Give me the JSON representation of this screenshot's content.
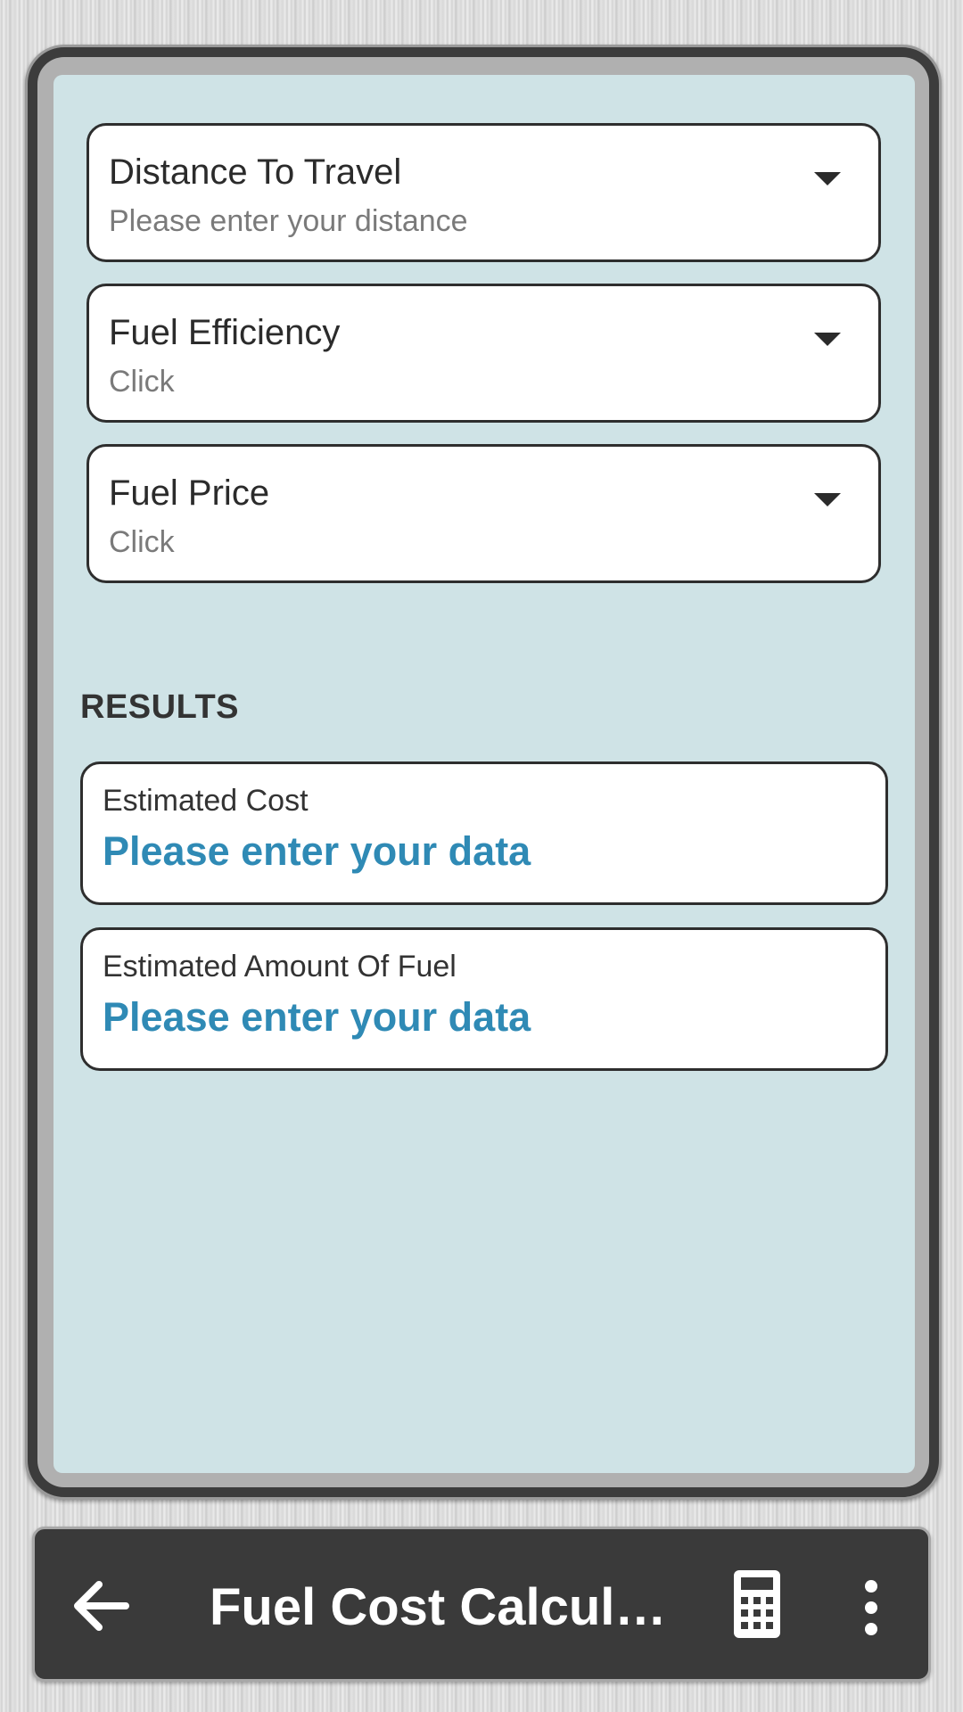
{
  "inputs": [
    {
      "title": "Distance To Travel",
      "subtitle": "Please enter your distance"
    },
    {
      "title": "Fuel Efficiency",
      "subtitle": "Click"
    },
    {
      "title": "Fuel Price",
      "subtitle": "Click"
    }
  ],
  "results": {
    "heading": "RESULTS",
    "cards": [
      {
        "label": "Estimated Cost",
        "value": "Please enter your data"
      },
      {
        "label": "Estimated Amount Of Fuel",
        "value": "Please enter your data"
      }
    ]
  },
  "toolbar": {
    "title": "Fuel Cost Calcul…",
    "back_icon": "arrow-left-icon",
    "calculator_icon": "calculator-icon",
    "more_icon": "more-vert-icon"
  },
  "colors": {
    "panel_background": "#cfe3e6",
    "result_value": "#2f8ab5",
    "toolbar_background": "#3a3a3a"
  }
}
